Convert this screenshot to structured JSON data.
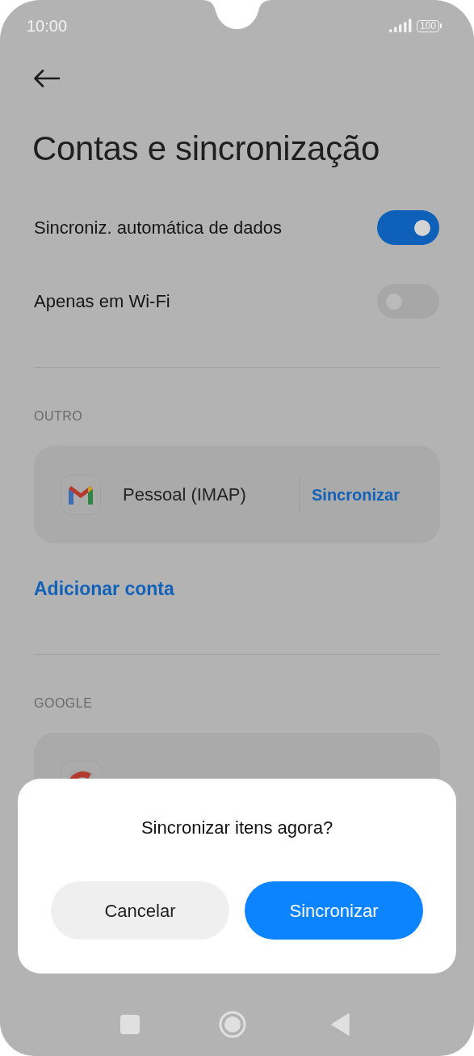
{
  "status_bar": {
    "time": "10:00",
    "battery": "100"
  },
  "title": "Contas e sincronização",
  "toggles": [
    {
      "label": "Sincroniz. automática de dados",
      "on": true
    },
    {
      "label": "Apenas em Wi-Fi",
      "on": false
    }
  ],
  "sections": [
    {
      "header": "OUTRO",
      "accounts": [
        {
          "kind": "gmail",
          "name": "Pessoal (IMAP)",
          "action": "Sincronizar"
        }
      ],
      "link": "Adicionar conta"
    },
    {
      "header": "GOOGLE",
      "accounts": [
        {
          "kind": "google"
        }
      ]
    }
  ],
  "dialog": {
    "title": "Sincronizar itens agora?",
    "buttons": [
      {
        "label": "Cancelar",
        "kind": "secondary"
      },
      {
        "label": "Sincronizar",
        "kind": "primary"
      }
    ]
  }
}
